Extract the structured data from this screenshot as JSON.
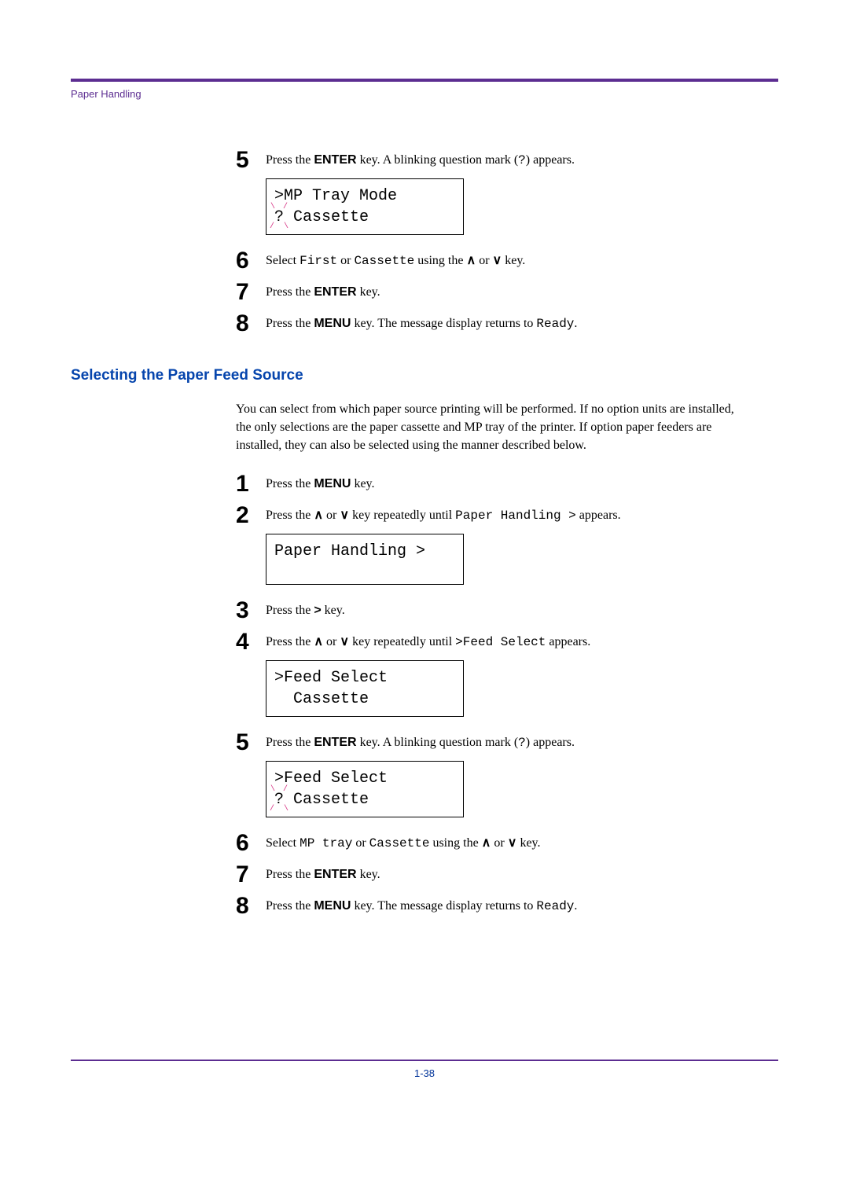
{
  "header": {
    "label": "Paper Handling"
  },
  "upper": {
    "s5": {
      "pre": "Press the ",
      "bold": "ENTER",
      "post": " key. A blinking question mark (",
      "mono": "?",
      "tail": ") appears."
    },
    "disp5_l1": ">MP Tray Mode",
    "disp5_q": "?",
    "disp5_l2_rest": " Cassette",
    "s6": {
      "pre": "Select ",
      "mono1": "First",
      "mid": " or ",
      "mono2": "Cassette",
      "post1": " using the ",
      "ar1": "∧",
      "or": " or ",
      "ar2": "∨",
      "tail": " key."
    },
    "s7": {
      "pre": "Press the ",
      "bold": "ENTER",
      "post": " key."
    },
    "s8": {
      "pre": "Press the ",
      "bold": "MENU",
      "post": " key. The message display returns to ",
      "mono": "Ready",
      "tail": "."
    }
  },
  "section_title": "Selecting the Paper Feed Source",
  "intro": "You can select from which paper source printing will be performed. If no option units are installed, the only selections are the paper cassette and MP tray of the printer. If option paper feeders are installed, they can also be selected using the manner described below.",
  "lower": {
    "s1": {
      "pre": "Press the ",
      "bold": "MENU",
      "post": " key."
    },
    "s2": {
      "pre": "Press the ",
      "ar1": "∧",
      "or": " or ",
      "ar2": "∨",
      "mid": " key repeatedly until ",
      "mono": "Paper Handling >",
      "tail": " appears."
    },
    "disp2_l1": "Paper Handling >",
    "s3": {
      "pre": "Press the ",
      "bold": ">",
      "post": " key."
    },
    "s4": {
      "pre": "Press the ",
      "ar1": "∧",
      "or": " or ",
      "ar2": "∨",
      "mid": " key repeatedly until ",
      "mono": ">Feed Select",
      "tail": " appears."
    },
    "disp4_l1": ">Feed Select",
    "disp4_l2": "  Cassette",
    "s5": {
      "pre": "Press the ",
      "bold": "ENTER",
      "post": " key. A blinking question mark (",
      "mono": "?",
      "tail": ") appears."
    },
    "disp5_l1": ">Feed Select",
    "disp5_q": "?",
    "disp5_l2_rest": " Cassette",
    "s6": {
      "pre": "Select ",
      "mono1": "MP tray",
      "mid": " or ",
      "mono2": "Cassette",
      "post1": " using the ",
      "ar1": "∧",
      "or": " or ",
      "ar2": "∨",
      "tail": " key."
    },
    "s7": {
      "pre": "Press the ",
      "bold": "ENTER",
      "post": " key."
    },
    "s8": {
      "pre": "Press the ",
      "bold": "MENU",
      "post": " key. The message display returns to ",
      "mono": "Ready",
      "tail": "."
    }
  },
  "page_num": "1-38",
  "nums": {
    "n1": "1",
    "n2": "2",
    "n3": "3",
    "n4": "4",
    "n5": "5",
    "n6": "6",
    "n7": "7",
    "n8": "8"
  }
}
